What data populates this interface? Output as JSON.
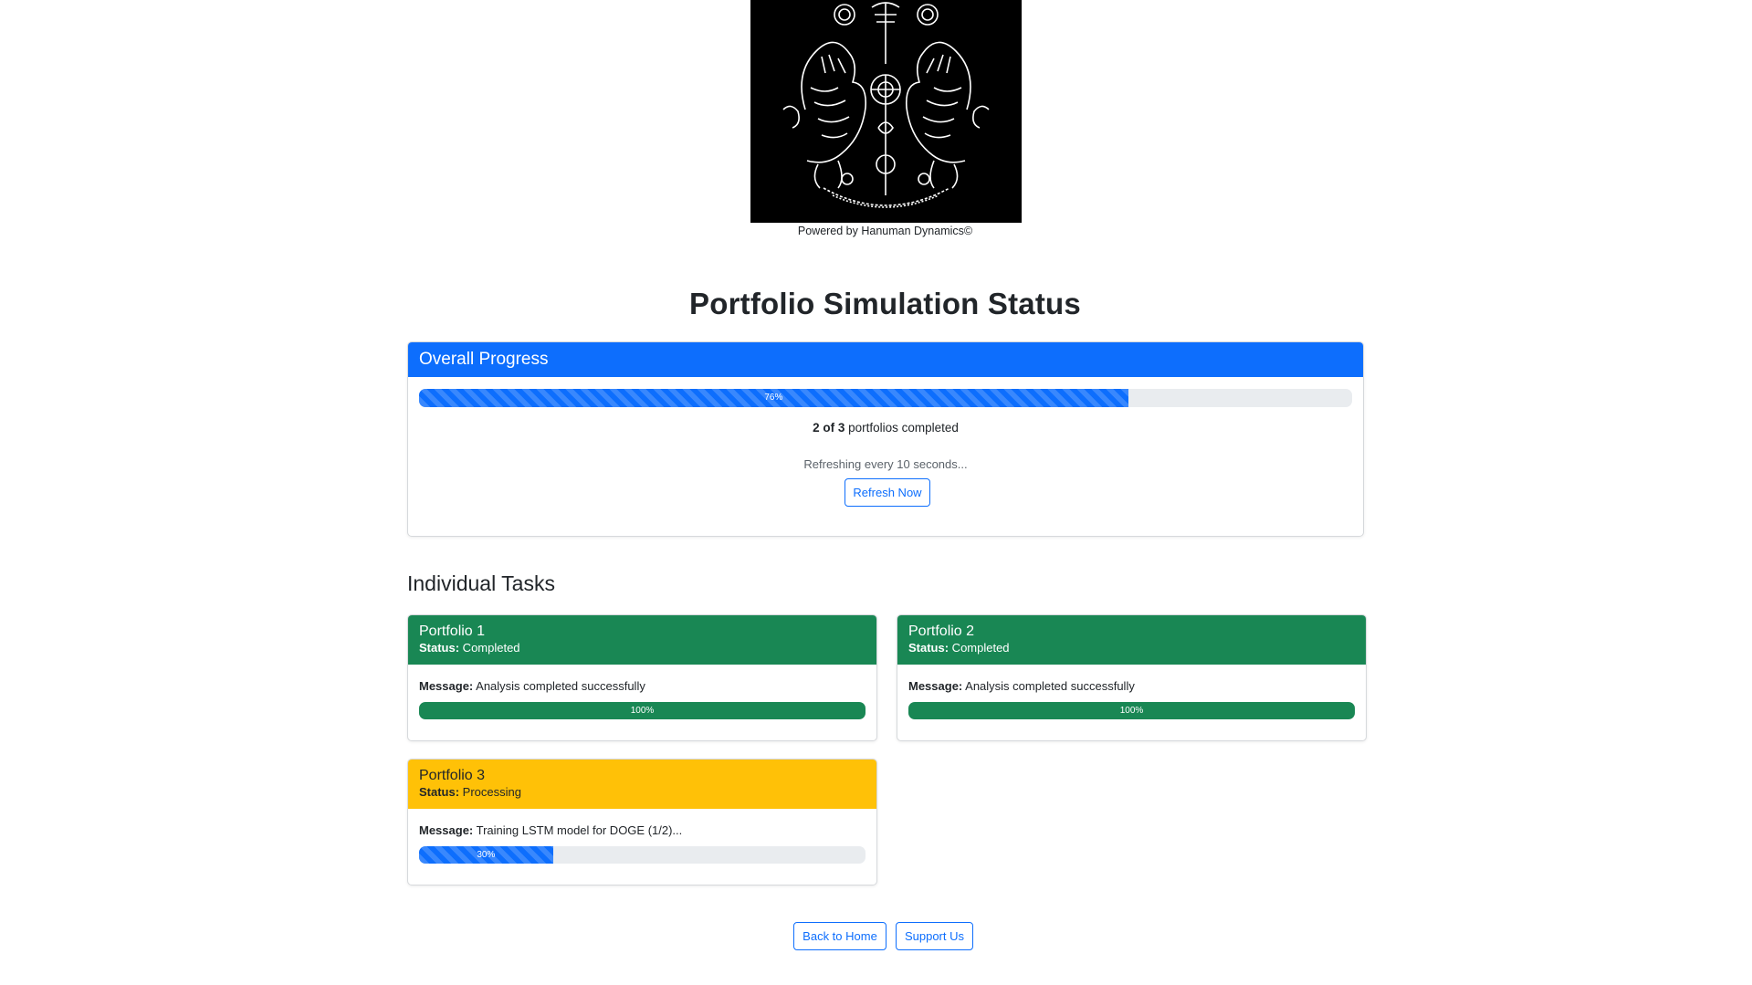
{
  "logo": {
    "icon": "twin-tigers-emblem-icon",
    "colors": {
      "background": "#000000",
      "foreground": "#ffffff"
    }
  },
  "footer_credit": "Powered by Hanuman Dynamics©",
  "page_title": "Portfolio Simulation Status",
  "overall": {
    "header": "Overall Progress",
    "progress_percent": 76,
    "progress_label": "76%",
    "completed_prefix": "2 of 3",
    "completed_suffix": " portfolios completed",
    "refresh_note": "Refreshing every 10 seconds...",
    "refresh_button": "Refresh Now"
  },
  "tasks_title": "Individual Tasks",
  "tasks": [
    {
      "title": "Portfolio 1",
      "status_label": "Status:",
      "status": " Completed",
      "message_label": "Message:",
      "message": " Analysis completed successfully",
      "progress_percent": 100,
      "progress_label": "100%",
      "header_color": "#198754"
    },
    {
      "title": "Portfolio 2",
      "status_label": "Status:",
      "status": " Completed",
      "message_label": "Message:",
      "message": " Analysis completed successfully",
      "progress_percent": 100,
      "progress_label": "100%",
      "header_color": "#198754"
    },
    {
      "title": "Portfolio 3",
      "status_label": "Status:",
      "status": " Processing",
      "message_label": "Message:",
      "message": " Training LSTM model for DOGE (1/2)...",
      "progress_percent": 30,
      "progress_label": "30%",
      "header_color": "#ffc107"
    }
  ],
  "nav": {
    "home_button": "Back to Home",
    "support_button": "Support Us"
  },
  "colors": {
    "primary": "#0d6efd",
    "success": "#198754",
    "warning": "#ffc107",
    "track": "#e9ecef"
  }
}
